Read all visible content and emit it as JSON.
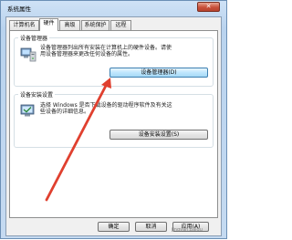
{
  "window": {
    "title": "系统属性",
    "close_glyph": "✕"
  },
  "tabs": [
    {
      "label": "计算机名"
    },
    {
      "label": "硬件",
      "active": true
    },
    {
      "label": "高级"
    },
    {
      "label": "系统保护"
    },
    {
      "label": "远程"
    }
  ],
  "device_manager": {
    "legend": "设备管理器",
    "description_line1": "设备管理器列出所有安装在计算机上的硬件设备。请使",
    "description_line2": "用设备管理器来更改任何设备的属性。",
    "button_label": "设备管理器(D)",
    "icon": "device-manager-icon"
  },
  "install_settings": {
    "legend": "设备安装设置",
    "description_line1": "选择 Windows 是否下载设备的驱动程序软件及有关这",
    "description_line2": "些设备的详细信息。",
    "button_label": "设备安装设置(S)",
    "icon": "device-install-icon"
  },
  "dialog_buttons": {
    "ok": "确定",
    "cancel": "取消",
    "apply": "应用(A)"
  },
  "annotation": {
    "arrow_color": "#e0402f"
  },
  "watermark": "jingyan.baidu"
}
